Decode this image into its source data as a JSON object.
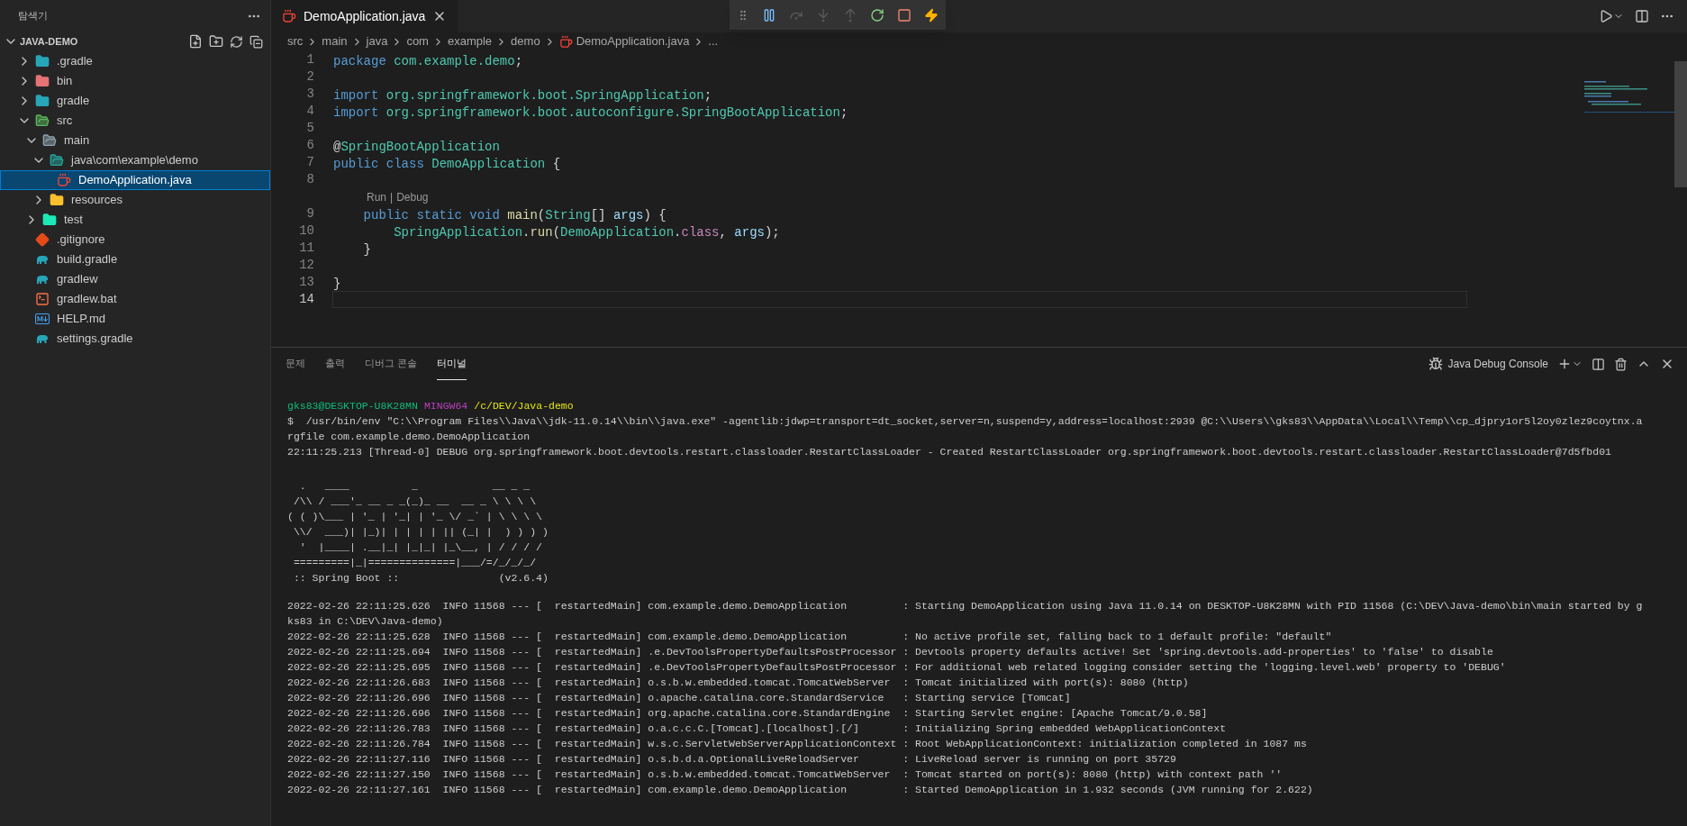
{
  "sidebar": {
    "title": "탐색기",
    "section": "JAVA-DEMO",
    "tree": [
      {
        "label": ".gradle",
        "kind": "gradle-folder",
        "expanded": false,
        "selected": false
      },
      {
        "label": "bin",
        "kind": "bin-folder",
        "expanded": false,
        "selected": false
      },
      {
        "label": "gradle",
        "kind": "gradle-folder",
        "expanded": false,
        "selected": false
      },
      {
        "label": "src",
        "kind": "src-folder",
        "expanded": true,
        "selected": false,
        "children": [
          {
            "label": "main",
            "kind": "folder",
            "expanded": true,
            "selected": false,
            "children": [
              {
                "label": "java\\com\\example\\demo",
                "kind": "package-folder",
                "expanded": true,
                "selected": false,
                "children": [
                  {
                    "label": "DemoApplication.java",
                    "kind": "java",
                    "selected": true
                  }
                ]
              },
              {
                "label": "resources",
                "kind": "resources-folder",
                "expanded": false,
                "selected": false
              }
            ]
          },
          {
            "label": "test",
            "kind": "test-folder",
            "expanded": false,
            "selected": false
          }
        ]
      },
      {
        "label": ".gitignore",
        "kind": "git",
        "selected": false
      },
      {
        "label": "build.gradle",
        "kind": "gradle",
        "selected": false
      },
      {
        "label": "gradlew",
        "kind": "gradle",
        "selected": false
      },
      {
        "label": "gradlew.bat",
        "kind": "terminal",
        "selected": false
      },
      {
        "label": "HELP.md",
        "kind": "markdown",
        "selected": false
      },
      {
        "label": "settings.gradle",
        "kind": "gradle",
        "selected": false
      }
    ]
  },
  "editor_tabs": [
    {
      "label": "DemoApplication.java",
      "selected": true
    }
  ],
  "debug_toolbar": [
    {
      "kind": "pause",
      "disabled": false
    },
    {
      "kind": "step-over",
      "disabled": true
    },
    {
      "kind": "step-into",
      "disabled": true
    },
    {
      "kind": "step-out",
      "disabled": true
    },
    {
      "kind": "restart",
      "disabled": false
    },
    {
      "kind": "stop",
      "disabled": false
    },
    {
      "kind": "hot-replace",
      "disabled": false
    }
  ],
  "breadcrumbs": [
    {
      "text": "src",
      "kind": "folder"
    },
    {
      "text": "main",
      "kind": "folder"
    },
    {
      "text": "java",
      "kind": "folder"
    },
    {
      "text": "com",
      "kind": "folder"
    },
    {
      "text": "example",
      "kind": "folder"
    },
    {
      "text": "demo",
      "kind": "folder"
    },
    {
      "text": "DemoApplication.java",
      "kind": "file"
    },
    {
      "text": "...",
      "kind": "more"
    }
  ],
  "code": [
    {
      "kind": "line",
      "number": "1",
      "current": false,
      "tokens": [
        {
          "text": "package ",
          "kind": "keyword"
        },
        {
          "text": "com.example.demo",
          "kind": "type"
        },
        {
          "text": ";",
          "kind": "plain"
        }
      ]
    },
    {
      "kind": "line",
      "number": "2",
      "current": false
    },
    {
      "kind": "line",
      "number": "3",
      "current": false,
      "tokens": [
        {
          "text": "import ",
          "kind": "keyword"
        },
        {
          "text": "org.springframework.boot.SpringApplication",
          "kind": "type"
        },
        {
          "text": ";",
          "kind": "plain"
        }
      ]
    },
    {
      "kind": "line",
      "number": "4",
      "current": false,
      "tokens": [
        {
          "text": "import ",
          "kind": "keyword"
        },
        {
          "text": "org.springframework.boot.autoconfigure.SpringBootApplication",
          "kind": "type"
        },
        {
          "text": ";",
          "kind": "plain"
        }
      ]
    },
    {
      "kind": "line",
      "number": "5",
      "current": false
    },
    {
      "kind": "line",
      "number": "6",
      "current": false,
      "tokens": [
        {
          "text": "@",
          "kind": "plain"
        },
        {
          "text": "SpringBootApplication",
          "kind": "type"
        }
      ]
    },
    {
      "kind": "line",
      "number": "7",
      "current": false,
      "tokens": [
        {
          "text": "public ",
          "kind": "keyword"
        },
        {
          "text": "class ",
          "kind": "keyword"
        },
        {
          "text": "DemoApplication",
          "kind": "type"
        },
        {
          "text": " {",
          "kind": "plain"
        }
      ]
    },
    {
      "kind": "line",
      "number": "8",
      "current": false
    },
    {
      "kind": "codelens",
      "links": [
        "Run",
        "Debug"
      ],
      "separator": "|"
    },
    {
      "kind": "line",
      "number": "9",
      "current": false,
      "tokens": [
        {
          "text": "    public static void ",
          "kind": "keyword"
        },
        {
          "text": "main",
          "kind": "function"
        },
        {
          "text": "(",
          "kind": "plain"
        },
        {
          "text": "String",
          "kind": "type"
        },
        {
          "text": "[] ",
          "kind": "plain"
        },
        {
          "text": "args",
          "kind": "variable"
        },
        {
          "text": ") {",
          "kind": "plain"
        }
      ]
    },
    {
      "kind": "line",
      "number": "10",
      "current": false,
      "tokens": [
        {
          "text": "        SpringApplication",
          "kind": "type"
        },
        {
          "text": ".",
          "kind": "plain"
        },
        {
          "text": "run",
          "kind": "function"
        },
        {
          "text": "(",
          "kind": "plain"
        },
        {
          "text": "DemoApplication",
          "kind": "type"
        },
        {
          "text": ".",
          "kind": "plain"
        },
        {
          "text": "class",
          "kind": "control"
        },
        {
          "text": ", ",
          "kind": "plain"
        },
        {
          "text": "args",
          "kind": "variable"
        },
        {
          "text": ");",
          "kind": "plain"
        }
      ]
    },
    {
      "kind": "line",
      "number": "11",
      "current": false,
      "tokens": [
        {
          "text": "    }",
          "kind": "plain"
        }
      ]
    },
    {
      "kind": "line",
      "number": "12",
      "current": false
    },
    {
      "kind": "line",
      "number": "13",
      "current": false,
      "tokens": [
        {
          "text": "}",
          "kind": "plain"
        }
      ]
    },
    {
      "kind": "line",
      "number": "14",
      "current": true
    }
  ],
  "panel_tabs": [
    {
      "label": "문제",
      "selected": false
    },
    {
      "label": "출력",
      "selected": false
    },
    {
      "label": "디버그 콘솔",
      "selected": false
    },
    {
      "label": "터미널",
      "selected": true
    }
  ],
  "terminal_selector": "Java Debug Console",
  "terminal": {
    "prompt": {
      "user": "gks83@DESKTOP-U8K28MN",
      "shell": "MINGW64",
      "path": "/c/DEV/Java-demo"
    },
    "output": [
      "$  /usr/bin/env \"C:\\\\Program Files\\\\Java\\\\jdk-11.0.14\\\\bin\\\\java.exe\" -agentlib:jdwp=transport=dt_socket,server=n,suspend=y,address=localhost:2939 @C:\\\\Users\\\\gks83\\\\AppData\\\\Local\\\\Temp\\\\cp_djpry1or5l2oy0zlez9coytnx.a",
      "rgfile com.example.demo.DemoApplication",
      "22:11:25.213 [Thread-0] DEBUG org.springframework.boot.devtools.restart.classloader.RestartClassLoader - Created RestartClassLoader org.springframework.boot.devtools.restart.classloader.RestartClassLoader@7d5fbd01"
    ],
    "banner": [
      "  .   ____          _            __ _ _",
      " /\\\\ / ___'_ __ _ _(_)_ __  __ _ \\ \\ \\ \\",
      "( ( )\\___ | '_ | '_| | '_ \\/ _` | \\ \\ \\ \\",
      " \\\\/  ___)| |_)| | | | | || (_| |  ) ) ) )",
      "  '  |____| .__|_| |_|_| |_\\__, | / / / /",
      " =========|_|==============|___/=/_/_/_/",
      " :: Spring Boot ::                (v2.6.4)"
    ],
    "log": [
      "2022-02-26 22:11:25.626  INFO 11568 --- [  restartedMain] com.example.demo.DemoApplication         : Starting DemoApplication using Java 11.0.14 on DESKTOP-U8K28MN with PID 11568 (C:\\DEV\\Java-demo\\bin\\main started by g",
      "ks83 in C:\\DEV\\Java-demo)",
      "2022-02-26 22:11:25.628  INFO 11568 --- [  restartedMain] com.example.demo.DemoApplication         : No active profile set, falling back to 1 default profile: \"default\"",
      "2022-02-26 22:11:25.694  INFO 11568 --- [  restartedMain] .e.DevToolsPropertyDefaultsPostProcessor : Devtools property defaults active! Set 'spring.devtools.add-properties' to 'false' to disable",
      "2022-02-26 22:11:25.695  INFO 11568 --- [  restartedMain] .e.DevToolsPropertyDefaultsPostProcessor : For additional web related logging consider setting the 'logging.level.web' property to 'DEBUG'",
      "2022-02-26 22:11:26.683  INFO 11568 --- [  restartedMain] o.s.b.w.embedded.tomcat.TomcatWebServer  : Tomcat initialized with port(s): 8080 (http)",
      "2022-02-26 22:11:26.696  INFO 11568 --- [  restartedMain] o.apache.catalina.core.StandardService   : Starting service [Tomcat]",
      "2022-02-26 22:11:26.696  INFO 11568 --- [  restartedMain] org.apache.catalina.core.StandardEngine  : Starting Servlet engine: [Apache Tomcat/9.0.58]",
      "2022-02-26 22:11:26.783  INFO 11568 --- [  restartedMain] o.a.c.c.C.[Tomcat].[localhost].[/]       : Initializing Spring embedded WebApplicationContext",
      "2022-02-26 22:11:26.784  INFO 11568 --- [  restartedMain] w.s.c.ServletWebServerApplicationContext : Root WebApplicationContext: initialization completed in 1087 ms",
      "2022-02-26 22:11:27.116  INFO 11568 --- [  restartedMain] o.s.b.d.a.OptionalLiveReloadServer       : LiveReload server is running on port 35729",
      "2022-02-26 22:11:27.150  INFO 11568 --- [  restartedMain] o.s.b.w.embedded.tomcat.TomcatWebServer  : Tomcat started on port(s): 8080 (http) with context path ''",
      "2022-02-26 22:11:27.161  INFO 11568 --- [  restartedMain] com.example.demo.DemoApplication         : Started DemoApplication in 1.932 seconds (JVM running for 2.622)"
    ]
  }
}
